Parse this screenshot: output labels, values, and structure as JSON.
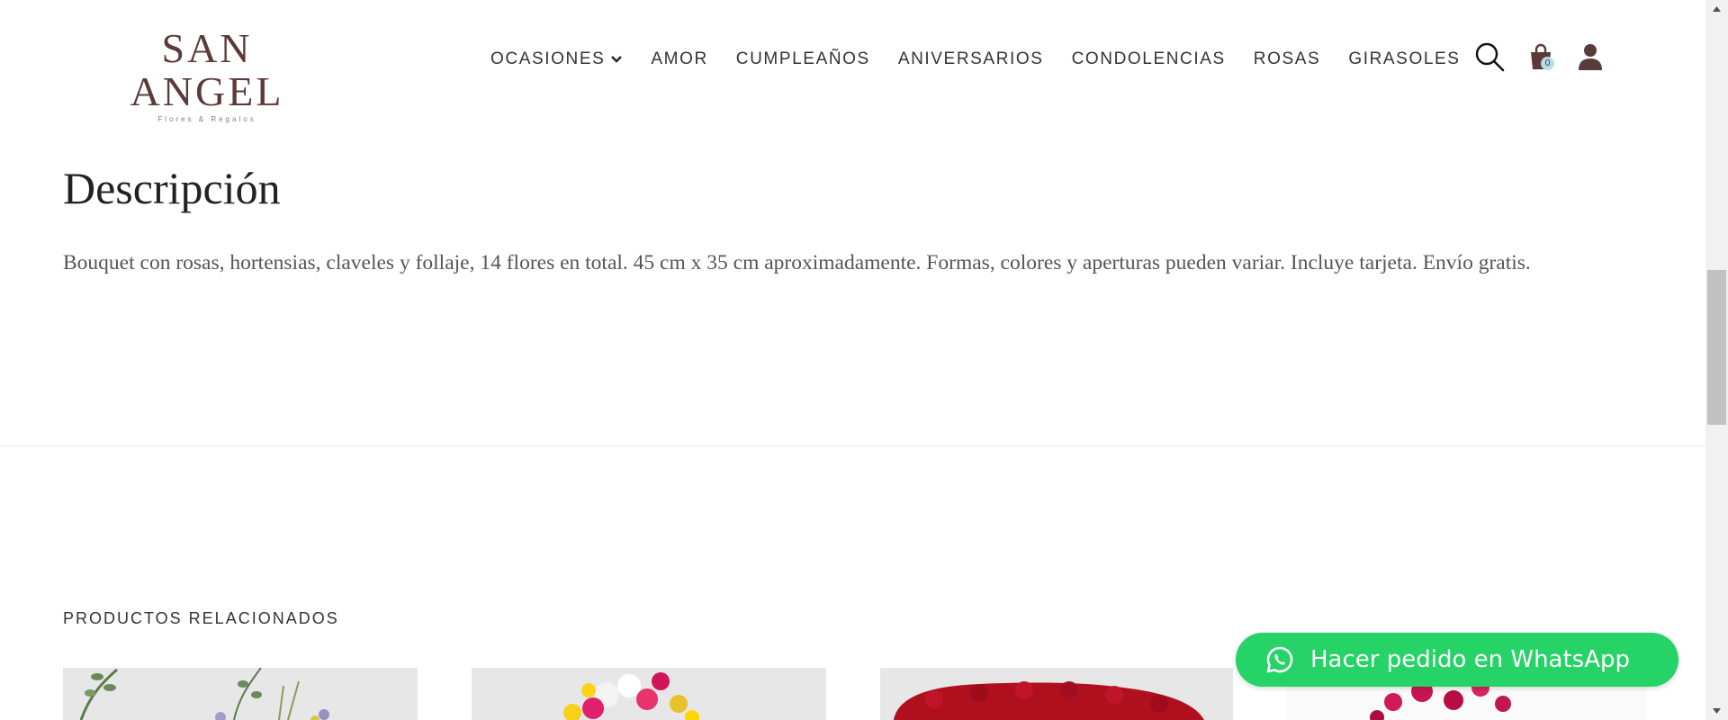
{
  "header": {
    "logo_main": "SAN ANGEL",
    "logo_sub": "Flores & Regalos",
    "nav": [
      "OCASIONES",
      "AMOR",
      "CUMPLEAÑOS",
      "ANIVERSARIOS",
      "CONDOLENCIAS",
      "ROSAS",
      "GIRASOLES"
    ],
    "cart_count": "0",
    "icons": [
      "search-icon",
      "shopping-bag-icon",
      "user-icon",
      "chevron-down-icon"
    ]
  },
  "description": {
    "title": "Descripción",
    "text": "Bouquet con rosas, hortensias, claveles y follaje, 14 flores en total. 45  cm x 35 cm aproximadamente. Formas, colores y aperturas pueden variar. Incluye tarjeta. Envío gratis."
  },
  "related": {
    "title": "PRODUCTOS RELACIONADOS"
  },
  "whatsapp": {
    "label": "Hacer pedido en WhatsApp",
    "icon": "whatsapp-icon"
  },
  "colors": {
    "brand": "#5b3a3a",
    "whatsapp": "#25d366",
    "badge": "#b5dcef"
  }
}
